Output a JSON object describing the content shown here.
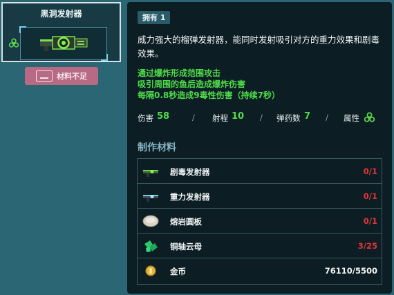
{
  "weapon": {
    "name": "黑洞发射器",
    "insufficient_label": "材料不足"
  },
  "detail": {
    "owned_label": "拥有 1",
    "description": "威力强大的榴弹发射器，能同时发射吸引对方的重力效果和剧毒效果。",
    "effects": [
      "通过爆炸形成范围攻击",
      "吸引周围的鱼后造成爆炸伤害",
      "每隔0.8秒造成9毒性伤害（持续7秒）"
    ],
    "stats": {
      "damage_label": "伤害",
      "damage_value": "58",
      "range_label": "射程",
      "range_value": "10",
      "ammo_label": "弹药数",
      "ammo_value": "7",
      "attribute_label": "属性",
      "attribute_icon": "biohazard-icon"
    },
    "separator": "/"
  },
  "materials": {
    "title": "制作材料",
    "items": [
      {
        "name": "剧毒发射器",
        "count": "0/1",
        "icon": "toxic-launcher-icon",
        "status": "insufficient"
      },
      {
        "name": "重力发射器",
        "count": "0/1",
        "icon": "gravity-launcher-icon",
        "status": "insufficient"
      },
      {
        "name": "熔岩圆板",
        "count": "0/1",
        "icon": "lava-disc-icon",
        "status": "insufficient"
      },
      {
        "name": "铜轴云母",
        "count": "3/25",
        "icon": "mica-crystal-icon",
        "status": "insufficient"
      },
      {
        "name": "金币",
        "count": "76110/5500",
        "icon": "gold-coin-icon",
        "status": "sufficient"
      }
    ]
  },
  "colors": {
    "background": "#2a6673",
    "panel": "#0c1d23",
    "accent_green": "#4fdc4a",
    "insufficient_red": "#e0363b",
    "button_pink": "#b86a84"
  }
}
